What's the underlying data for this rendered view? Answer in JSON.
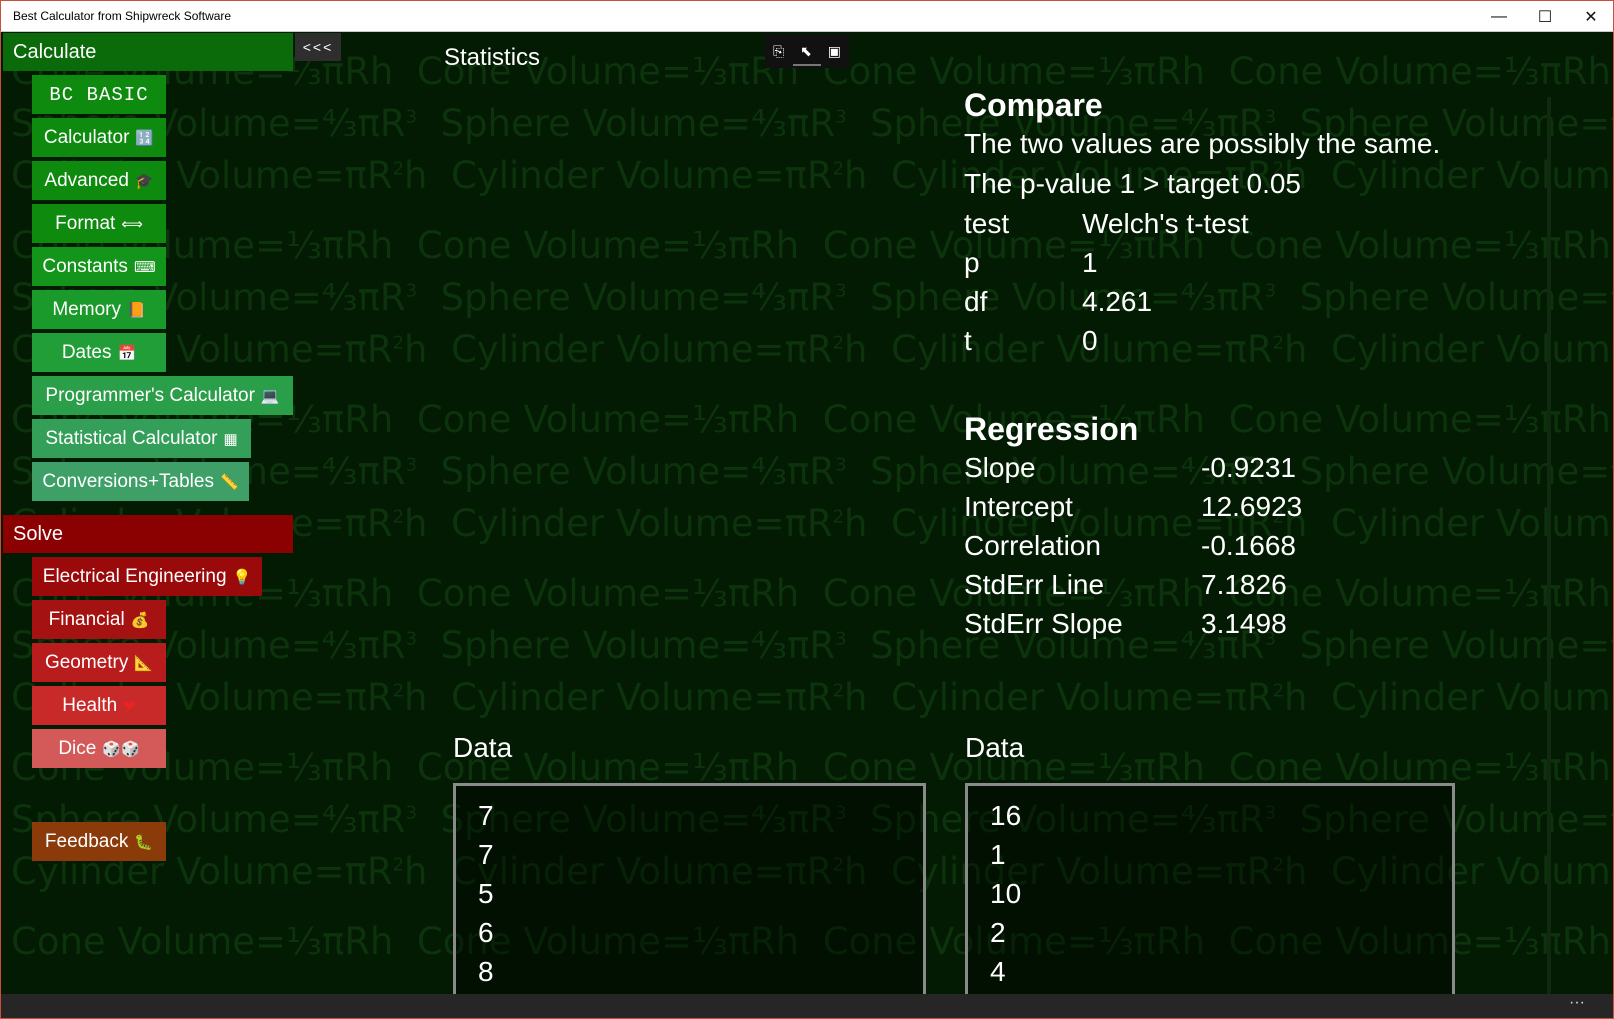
{
  "window": {
    "title": "Best Calculator from Shipwreck Software"
  },
  "nav": {
    "calculate_header": "Calculate",
    "collapse_label": "<<<",
    "calc_items": [
      {
        "label": "BC BASIC",
        "icon": ""
      },
      {
        "label": "Calculator",
        "icon": "🔢"
      },
      {
        "label": "Advanced",
        "icon": "🎓"
      },
      {
        "label": "Format",
        "icon": "⟺"
      },
      {
        "label": "Constants",
        "icon": "⌨"
      },
      {
        "label": "Memory",
        "icon": "📙"
      },
      {
        "label": "Dates",
        "icon": "📅"
      },
      {
        "label": "Programmer's Calculator",
        "icon": "💻"
      },
      {
        "label": "Statistical Calculator",
        "icon": "▦"
      },
      {
        "label": "Conversions+Tables",
        "icon": "📏"
      }
    ],
    "solve_header": "Solve",
    "solve_items": [
      {
        "label": "Electrical Engineering",
        "icon": "💡"
      },
      {
        "label": "Financial",
        "icon": "💰"
      },
      {
        "label": "Geometry",
        "icon": "📐"
      },
      {
        "label": "Health",
        "icon": "❤"
      },
      {
        "label": "Dice",
        "icon": "🎲🎲"
      }
    ],
    "feedback": {
      "label": "Feedback",
      "icon": "🐛"
    }
  },
  "page": {
    "title": "Statistics"
  },
  "compare": {
    "heading": "Compare",
    "line1": "The two values are possibly the same.",
    "line2": "The p-value 1 > target 0.05",
    "rows": [
      {
        "k": "test",
        "v": "Welch's t-test"
      },
      {
        "k": "p",
        "v": "1"
      },
      {
        "k": "df",
        "v": "4.261"
      },
      {
        "k": "t",
        "v": "0"
      }
    ]
  },
  "regression": {
    "heading": "Regression",
    "rows": [
      {
        "k": "Slope",
        "v": "-0.9231"
      },
      {
        "k": "Intercept",
        "v": "12.6923"
      },
      {
        "k": "Correlation",
        "v": "-0.1668"
      },
      {
        "k": "StdErr Line",
        "v": "7.1826"
      },
      {
        "k": "StdErr Slope",
        "v": "3.1498"
      }
    ]
  },
  "data1": {
    "label": "Data",
    "values": [
      "7",
      "7",
      "5",
      "6",
      "8"
    ]
  },
  "data2": {
    "label": "Data",
    "values": [
      "16",
      "1",
      "10",
      "2",
      "4"
    ]
  },
  "colors": {
    "background": "#031a03",
    "calc_header": "#0b6b0b",
    "solve_header": "#8b0000",
    "feedback": "#8b3a0a"
  }
}
